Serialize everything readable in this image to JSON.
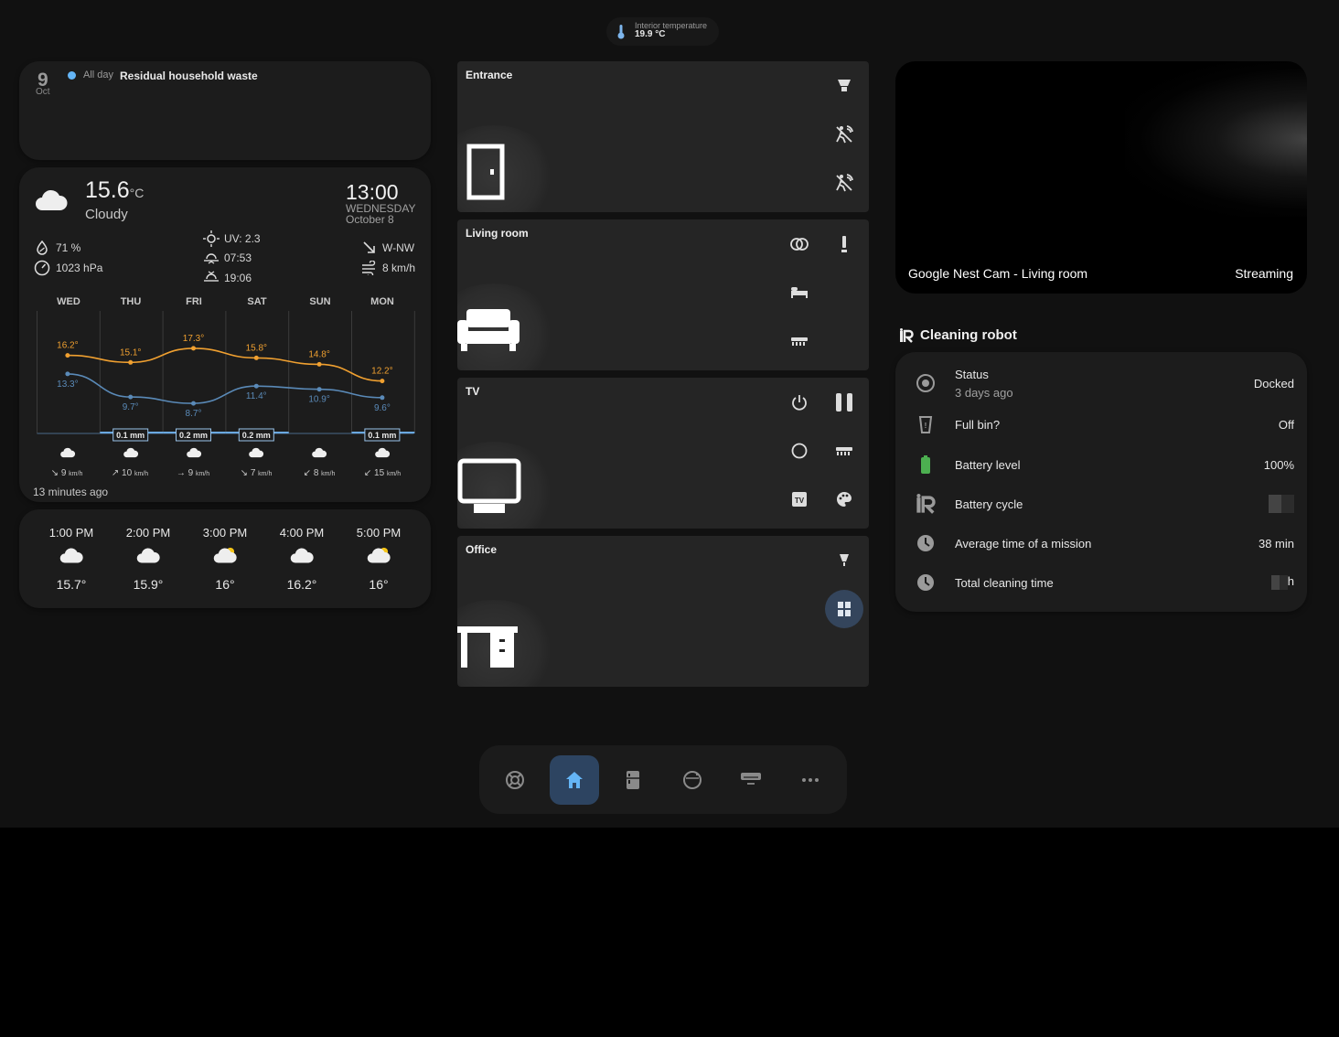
{
  "header": {
    "label": "Interior temperature",
    "value": "19.9 °C"
  },
  "calendar": {
    "day": "9",
    "month": "Oct",
    "allday": "All day",
    "title": "Residual household waste"
  },
  "weather": {
    "temp": "15.6",
    "unit": "°C",
    "condition": "Cloudy",
    "time": "13:00",
    "weekday": "WEDNESDAY",
    "date": "October 8",
    "humidity": "71 %",
    "pressure": "1023 hPa",
    "uv": "UV: 2.3",
    "sunrise": "07:53",
    "sunset": "19:06",
    "wind_dir": "W-NW",
    "wind_speed": "8 km/h",
    "updated": "13 minutes ago",
    "wind_unit": "km/h",
    "forecast": [
      {
        "day": "WED",
        "high": "16.2°",
        "low": "13.3°",
        "precip": "",
        "wind_arrow": "↘",
        "wind": "9"
      },
      {
        "day": "THU",
        "high": "15.1°",
        "low": "9.7°",
        "precip": "0.1 mm",
        "wind_arrow": "↗",
        "wind": "10"
      },
      {
        "day": "FRI",
        "high": "17.3°",
        "low": "8.7°",
        "precip": "0.2 mm",
        "wind_arrow": "→",
        "wind": "9"
      },
      {
        "day": "SAT",
        "high": "15.8°",
        "low": "11.4°",
        "precip": "0.2 mm",
        "wind_arrow": "↘",
        "wind": "7"
      },
      {
        "day": "SUN",
        "high": "14.8°",
        "low": "10.9°",
        "precip": "",
        "wind_arrow": "↙",
        "wind": "8"
      },
      {
        "day": "MON",
        "high": "12.2°",
        "low": "9.6°",
        "precip": "0.1 mm",
        "wind_arrow": "↙",
        "wind": "15"
      }
    ],
    "high_color": "#f0a030",
    "low_color": "#5a8ab8"
  },
  "hourly": [
    {
      "time": "1:00 PM",
      "temp": "15.7°",
      "icon": "cloudy-icon"
    },
    {
      "time": "2:00 PM",
      "temp": "15.9°",
      "icon": "cloudy-icon"
    },
    {
      "time": "3:00 PM",
      "temp": "16°",
      "icon": "partly-sunny-icon"
    },
    {
      "time": "4:00 PM",
      "temp": "16.2°",
      "icon": "cloudy-icon"
    },
    {
      "time": "5:00 PM",
      "temp": "16°",
      "icon": "partly-sunny-icon"
    }
  ],
  "rooms": {
    "entrance": {
      "title": "Entrance"
    },
    "living": {
      "title": "Living room"
    },
    "tv": {
      "title": "TV"
    },
    "office": {
      "title": "Office"
    }
  },
  "camera": {
    "name": "Google Nest Cam - Living room",
    "state": "Streaming"
  },
  "robot": {
    "title": "Cleaning robot",
    "rows": [
      {
        "name": "Status",
        "sub": "3 days ago",
        "value": "Docked"
      },
      {
        "name": "Full bin?",
        "value": "Off"
      },
      {
        "name": "Battery level",
        "value": "100%"
      },
      {
        "name": "Battery cycle",
        "value": ""
      },
      {
        "name": "Average time of a mission",
        "value": "38 min"
      },
      {
        "name": "Total cleaning time",
        "value": "h"
      }
    ],
    "battery_color": "#4caf50"
  },
  "nav": [
    "lifebuoy-icon",
    "home-icon",
    "fridge-icon",
    "robot-vacuum-icon",
    "air-conditioner-icon",
    "more-icon"
  ],
  "accent": "#64b5f6"
}
